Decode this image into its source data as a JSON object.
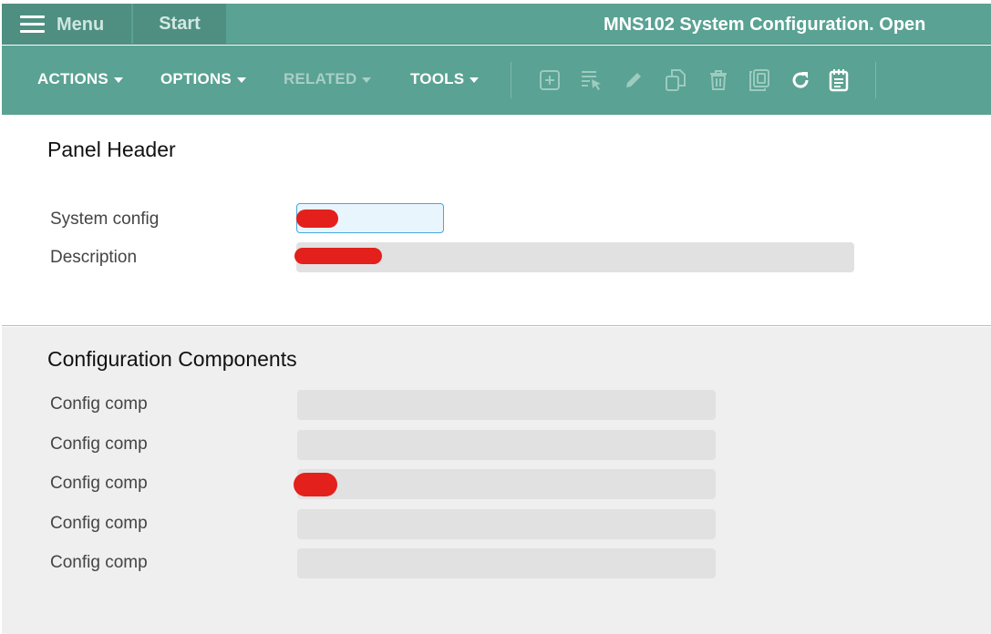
{
  "app": {
    "menu_label": "Menu",
    "start_tab": "Start",
    "window_title": "MNS102 System Configuration. Open"
  },
  "toolbar": {
    "menus": [
      {
        "label": "ACTIONS",
        "enabled": true
      },
      {
        "label": "OPTIONS",
        "enabled": true
      },
      {
        "label": "RELATED",
        "enabled": false
      },
      {
        "label": "TOOLS",
        "enabled": true
      }
    ],
    "icons": [
      "add-icon",
      "select-list-icon",
      "edit-pencil-icon",
      "copy-icon",
      "delete-trash-icon",
      "duplicate-icon",
      "refresh-icon",
      "notes-icon"
    ]
  },
  "panel_header": {
    "title": "Panel Header",
    "fields": [
      {
        "label": "System config",
        "value": ""
      },
      {
        "label": "Description",
        "value": ""
      }
    ]
  },
  "components": {
    "title": "Configuration Components",
    "rows": [
      {
        "label": "Config comp",
        "value": ""
      },
      {
        "label": "Config comp",
        "value": ""
      },
      {
        "label": "Config comp",
        "value": ""
      },
      {
        "label": "Config comp",
        "value": ""
      },
      {
        "label": "Config comp",
        "value": ""
      }
    ]
  },
  "colors": {
    "header_bg": "#5aa293",
    "tab_bg": "#4e8f82",
    "field_bg": "#e1e1e1",
    "focus_border": "#49a7dc",
    "section_bg": "#efefef"
  }
}
